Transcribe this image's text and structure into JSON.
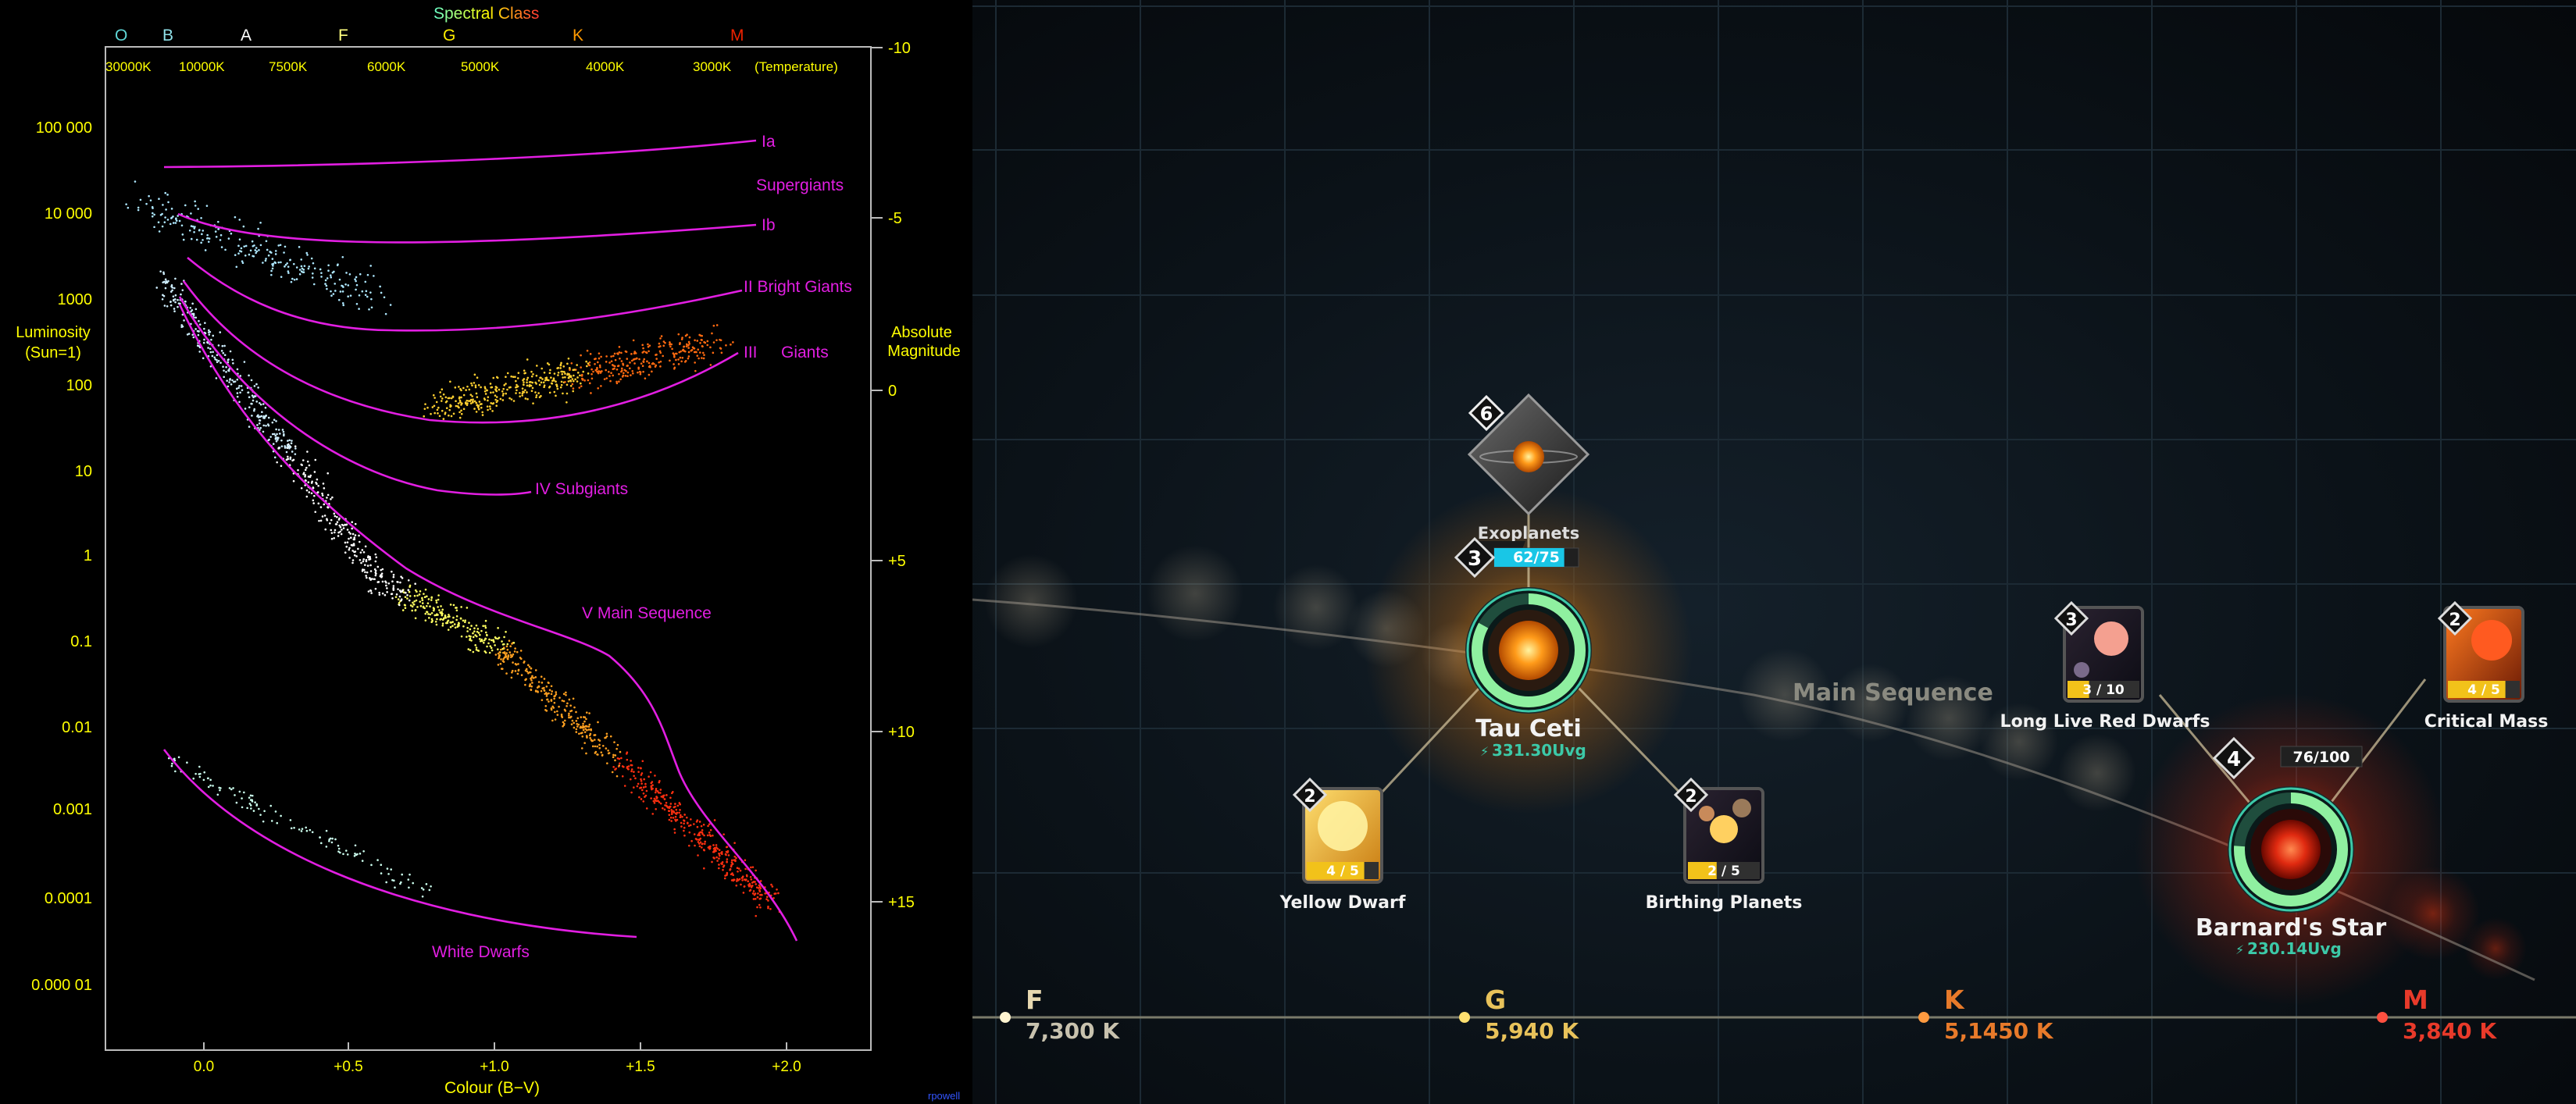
{
  "hr_diagram": {
    "spectral_title": "Spectral Class",
    "spectral_classes": [
      "O",
      "B",
      "A",
      "F",
      "G",
      "K",
      "M"
    ],
    "temperatures": [
      "30000K",
      "10000K",
      "7500K",
      "6000K",
      "5000K",
      "4000K",
      "3000K"
    ],
    "temperature_caption": "(Temperature)",
    "luminosity_label_1": "Luminosity",
    "luminosity_label_2": "(Sun=1)",
    "luminosity_ticks": [
      "100 000",
      "10 000",
      "1000",
      "100",
      "10",
      "1",
      "0.1",
      "0.01",
      "0.001",
      "0.0001",
      "0.000 01"
    ],
    "magnitude_label_1": "Absolute",
    "magnitude_label_2": "Magnitude",
    "magnitude_ticks": [
      "-10",
      "-5",
      "0",
      "+5",
      "+10",
      "+15"
    ],
    "colour_ticks": [
      "0.0",
      "+0.5",
      "+1.0",
      "+1.5",
      "+2.0"
    ],
    "x_axis_label": "Colour (B−V)",
    "class_labels": {
      "ia": "Ia",
      "supergiants": "Supergiants",
      "ib": "Ib",
      "bright_giants": "II Bright Giants",
      "giants_num": "III",
      "giants": "Giants",
      "subgiants": "IV Subgiants",
      "main_sequence": "V  Main Sequence",
      "white_dwarfs": "White Dwarfs"
    },
    "corner_mark": "rpowell"
  },
  "game": {
    "band_label": "Main Sequence",
    "spectral_axis": [
      {
        "class": "F",
        "temp": "7,300 K",
        "color": "#e8d9b0"
      },
      {
        "class": "G",
        "temp": "5,940 K",
        "color": "#e8c25a"
      },
      {
        "class": "K",
        "temp": "5,1450 K",
        "color": "#e87a2a"
      },
      {
        "class": "M",
        "temp": "3,840 K",
        "color": "#e83a2a"
      }
    ],
    "upgrade_node": {
      "count": "6",
      "label": "Exoplanets"
    },
    "stars": [
      {
        "name": "Tau Ceti",
        "level": "3",
        "progress_text": "62/75",
        "progress": 0.83,
        "cost": "331.30Uvg"
      },
      {
        "name": "Barnard's Star",
        "level": "4",
        "progress_text": "76/100",
        "progress": 0.76,
        "cost": "230.14Uvg"
      }
    ],
    "cards": [
      {
        "name": "Yellow Dwarf",
        "level": "2",
        "progress_text": "4 / 5",
        "progress": 0.8
      },
      {
        "name": "Birthing Planets",
        "level": "2",
        "progress_text": "2 / 5",
        "progress": 0.4
      },
      {
        "name": "Long Live Red Dwarfs",
        "level": "3",
        "progress_text": "3 / 10",
        "progress": 0.3
      },
      {
        "name": "Critical Mass",
        "level": "2",
        "progress_text": "4 / 5",
        "progress": 0.8
      }
    ],
    "colors": {
      "accent": "#3cc9a8",
      "progress_cyan": "#19c6e6",
      "progress_green": "#8ff0a0",
      "card_fill": "#f2c21a"
    }
  }
}
